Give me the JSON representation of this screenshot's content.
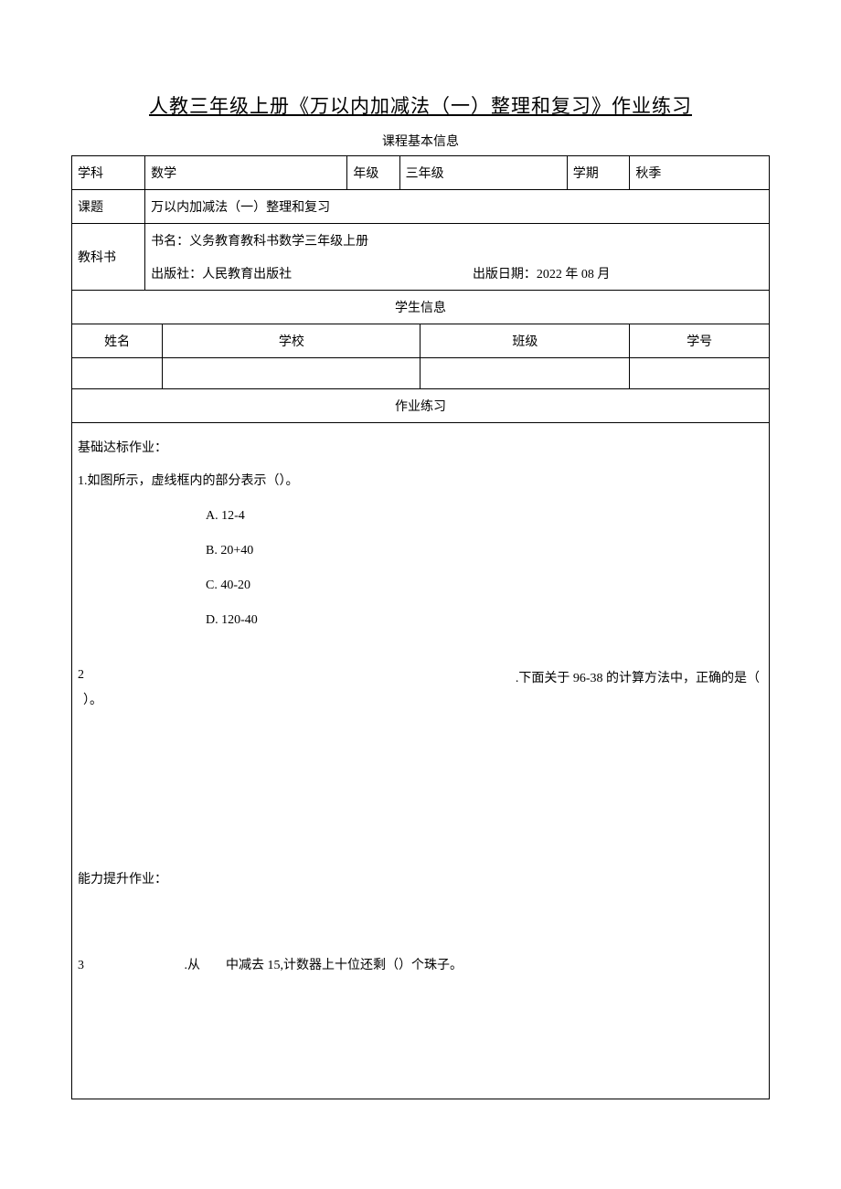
{
  "title": "人教三年级上册《万以内加减法（一）整理和复习》作业练习",
  "section_course_info": "课程基本信息",
  "row1": {
    "label_subject": "学科",
    "subject": "数学",
    "label_grade": "年级",
    "grade": "三年级",
    "label_term": "学期",
    "term": "秋季"
  },
  "row2": {
    "label_topic": "课题",
    "topic": "万以内加减法（一）整理和复习"
  },
  "row3": {
    "label_textbook": "教科书",
    "book_name": "书名：义务教育教科书数学三年级上册",
    "publisher": "出版社：人民教育出版社",
    "pub_date": "出版日期：2022 年 08 月"
  },
  "section_student_info": "学生信息",
  "student_headers": {
    "name": "姓名",
    "school": "学校",
    "class": "班级",
    "id": "学号"
  },
  "section_homework": "作业练习",
  "hw": {
    "basic_label": "基础达标作业：",
    "q1": {
      "stem": "1.如图所示，虚线框内的部分表示（）。",
      "a": "A. 12-4",
      "b": "B. 20+40",
      "c": "C. 40-20",
      "d": "D. 120-40"
    },
    "q2": {
      "num": "2",
      "text": ".下面关于 96-38 的计算方法中，正确的是（",
      "tail": "）。"
    },
    "ability_label": "能力提升作业：",
    "q3": {
      "num": "3",
      "dot_from": ".从",
      "text": "中减去 15,计数器上十位还剩（）个珠子。"
    }
  }
}
